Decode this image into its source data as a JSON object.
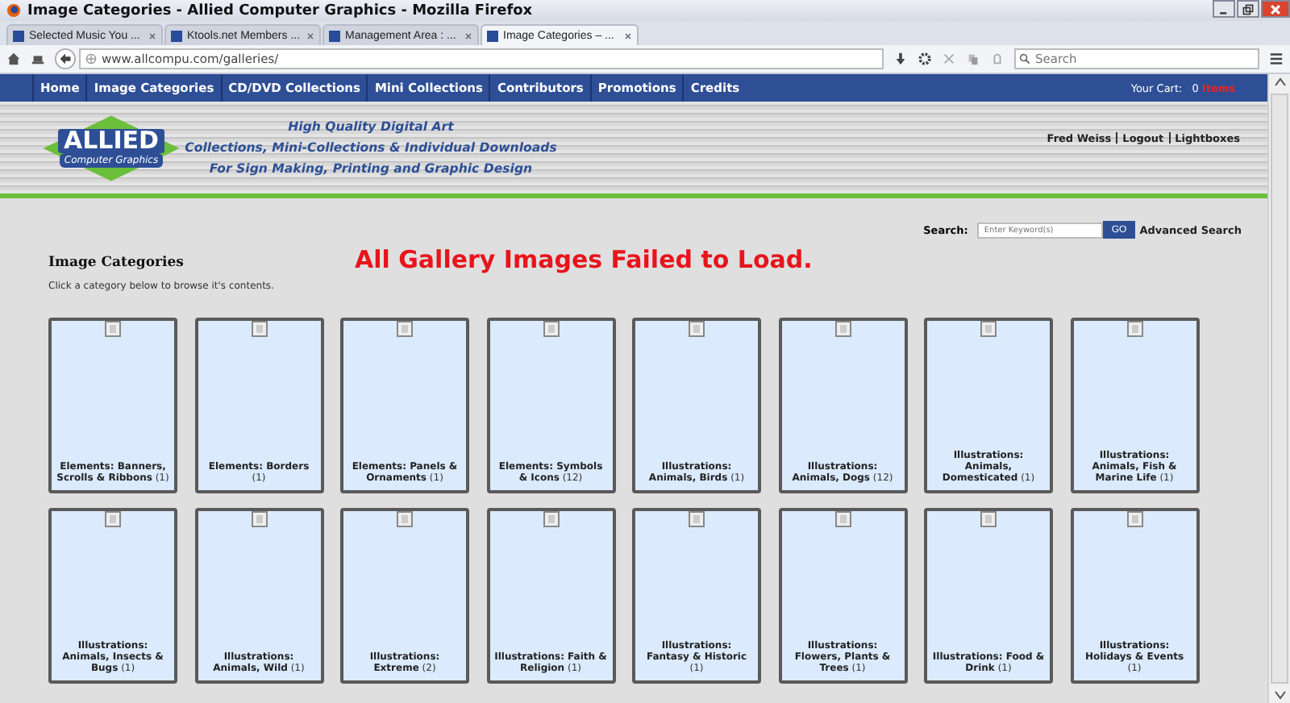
{
  "window": {
    "title": "Image Categories - Allied Computer Graphics - Mozilla Firefox"
  },
  "tabs": [
    {
      "label": "Selected Music You ...",
      "selected": false
    },
    {
      "label": "Ktools.net Members ...",
      "selected": false
    },
    {
      "label": "Management Area : ...",
      "selected": false
    },
    {
      "label": "Image Categories – ...",
      "selected": true
    }
  ],
  "address_bar": {
    "value": "www.allcompu.com/galleries/"
  },
  "browser_search": {
    "placeholder": "Search"
  },
  "site_nav": [
    "Home",
    "Image Categories",
    "CD/DVD Collections",
    "Mini Collections",
    "Contributors",
    "Promotions",
    "Credits"
  ],
  "cart": {
    "label": "Your Cart:",
    "count": "0",
    "unit": "Items"
  },
  "logo": {
    "name": "ALLIED",
    "subtitle": "Computer Graphics"
  },
  "taglines": [
    "High Quality Digital Art",
    "Collections, Mini-Collections & Individual Downloads",
    "For Sign Making, Printing and Graphic Design"
  ],
  "user_links": [
    "Fred Weiss",
    "Logout",
    "Lightboxes"
  ],
  "site_search": {
    "label": "Search:",
    "placeholder": "Enter Keyword(s)",
    "button": "GO",
    "advanced": "Advanced Search"
  },
  "heading": "Image Categories",
  "intro": "Click a category below to browse it's contents.",
  "alert": "All Gallery Images Failed to Load.",
  "categories": [
    {
      "name": "Elements: Banners, Scrolls & Ribbons",
      "count": "(1)"
    },
    {
      "name": "Elements: Borders",
      "count": "(1)"
    },
    {
      "name": "Elements: Panels & Ornaments",
      "count": "(1)"
    },
    {
      "name": "Elements: Symbols & Icons",
      "count": "(12)"
    },
    {
      "name": "Illustrations: Animals, Birds",
      "count": "(1)"
    },
    {
      "name": "Illustrations: Animals, Dogs",
      "count": "(12)"
    },
    {
      "name": "Illustrations: Animals, Domesticated",
      "count": "(1)"
    },
    {
      "name": "Illustrations: Animals, Fish & Marine Life",
      "count": "(1)"
    },
    {
      "name": "Illustrations: Animals, Insects & Bugs",
      "count": "(1)"
    },
    {
      "name": "Illustrations: Animals, Wild",
      "count": "(1)"
    },
    {
      "name": "Illustrations: Extreme",
      "count": "(2)"
    },
    {
      "name": "Illustrations: Faith & Religion",
      "count": "(1)"
    },
    {
      "name": "Illustrations: Fantasy & Historic",
      "count": "(1)"
    },
    {
      "name": "Illustrations: Flowers, Plants & Trees",
      "count": "(1)"
    },
    {
      "name": "Illustrations: Food & Drink",
      "count": "(1)"
    },
    {
      "name": "Illustrations: Holidays & Events",
      "count": "(1)"
    }
  ]
}
